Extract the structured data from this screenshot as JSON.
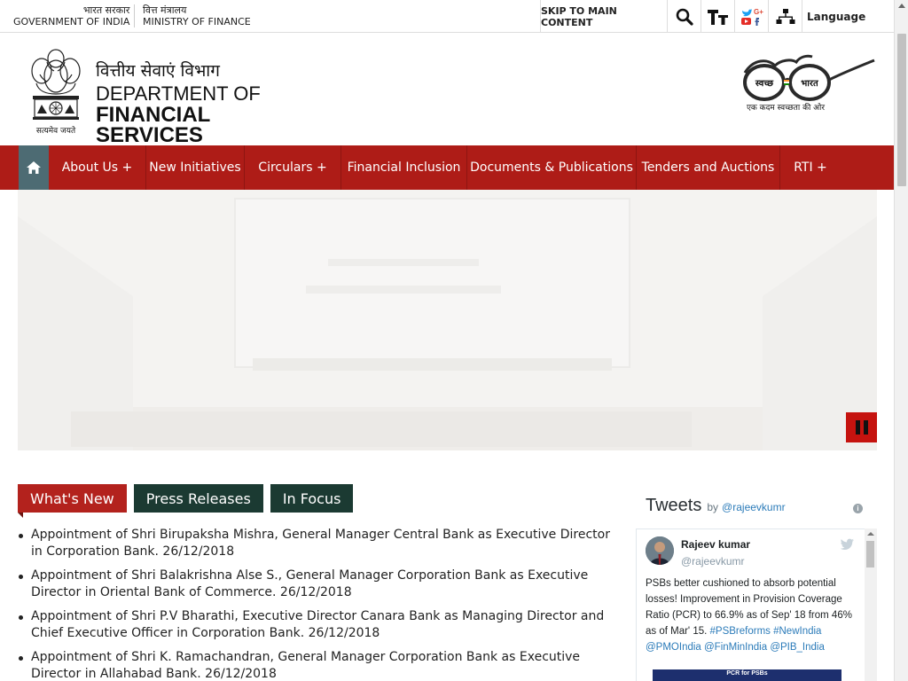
{
  "topbar": {
    "gov_hi": "भारत सरकार",
    "gov_en": "GOVERNMENT OF INDIA",
    "ministry_hi": "वित्त मंत्रालय",
    "ministry_en": "MINISTRY OF FINANCE",
    "skip_label": "SKIP TO MAIN CONTENT",
    "icons": [
      "search-icon",
      "text-size-icon",
      "social-media-icon",
      "sitemap-icon"
    ],
    "language_label": "Language"
  },
  "brand": {
    "dept_hi": "वित्तीय सेवाएं विभाग",
    "dept_en_line1": "DEPARTMENT OF",
    "dept_en_line2": "FINANCIAL",
    "dept_en_line3": "SERVICES",
    "emblem_motto": "सत्यमेव जयते",
    "swachh_left": "स्वच्छ",
    "swachh_right": "भारत",
    "swachh_tagline": "एक कदम स्वच्छता की ओर"
  },
  "nav": {
    "items": [
      {
        "label": "About Us +"
      },
      {
        "label": "New Initiatives"
      },
      {
        "label": "Circulars +"
      },
      {
        "label": "Financial Inclusion"
      },
      {
        "label": "Documents & Publications"
      },
      {
        "label": "Tenders and Auctions"
      },
      {
        "label": "RTI +"
      }
    ]
  },
  "tabs": [
    {
      "label": "What's New",
      "active": true
    },
    {
      "label": "Press Releases",
      "active": false
    },
    {
      "label": "In Focus",
      "active": false
    }
  ],
  "news": [
    "Appointment of Shri Birupaksha Mishra, General Manager Central Bank as Executive Director in Corporation Bank. 26/12/2018",
    "Appointment of Shri Balakrishna Alse S., General Manager Corporation Bank as Executive Director in Oriental Bank of Commerce. 26/12/2018",
    "Appointment of Shri P.V Bharathi, Executive Director Canara Bank as Managing Director and Chief Executive Officer in Corporation Bank. 26/12/2018",
    "Appointment of Shri K. Ramachandran, General Manager Corporation Bank as Executive Director in Allahabad Bank. 26/12/2018"
  ],
  "tweets": {
    "title": "Tweets",
    "by": "by",
    "handle": "@rajeevkumr",
    "info": "i",
    "author_name": "Rajeev kumar",
    "author_handle": "@rajeevkumr",
    "text": "PSBs better cushioned to absorb potential losses! Improvement in Provision Coverage Ratio (PCR) to 66.9% as of Sep' 18 from 46% as of Mar' 15.",
    "tags": "#PSBreforms #NewIndia @PMOIndia @FinMinIndia @PIB_India",
    "media_caption": "PCR for PSBs"
  },
  "colors": {
    "nav_red": "#ae1c17",
    "home_slate": "#4d6b73",
    "tab_dark": "#1b3a32"
  }
}
